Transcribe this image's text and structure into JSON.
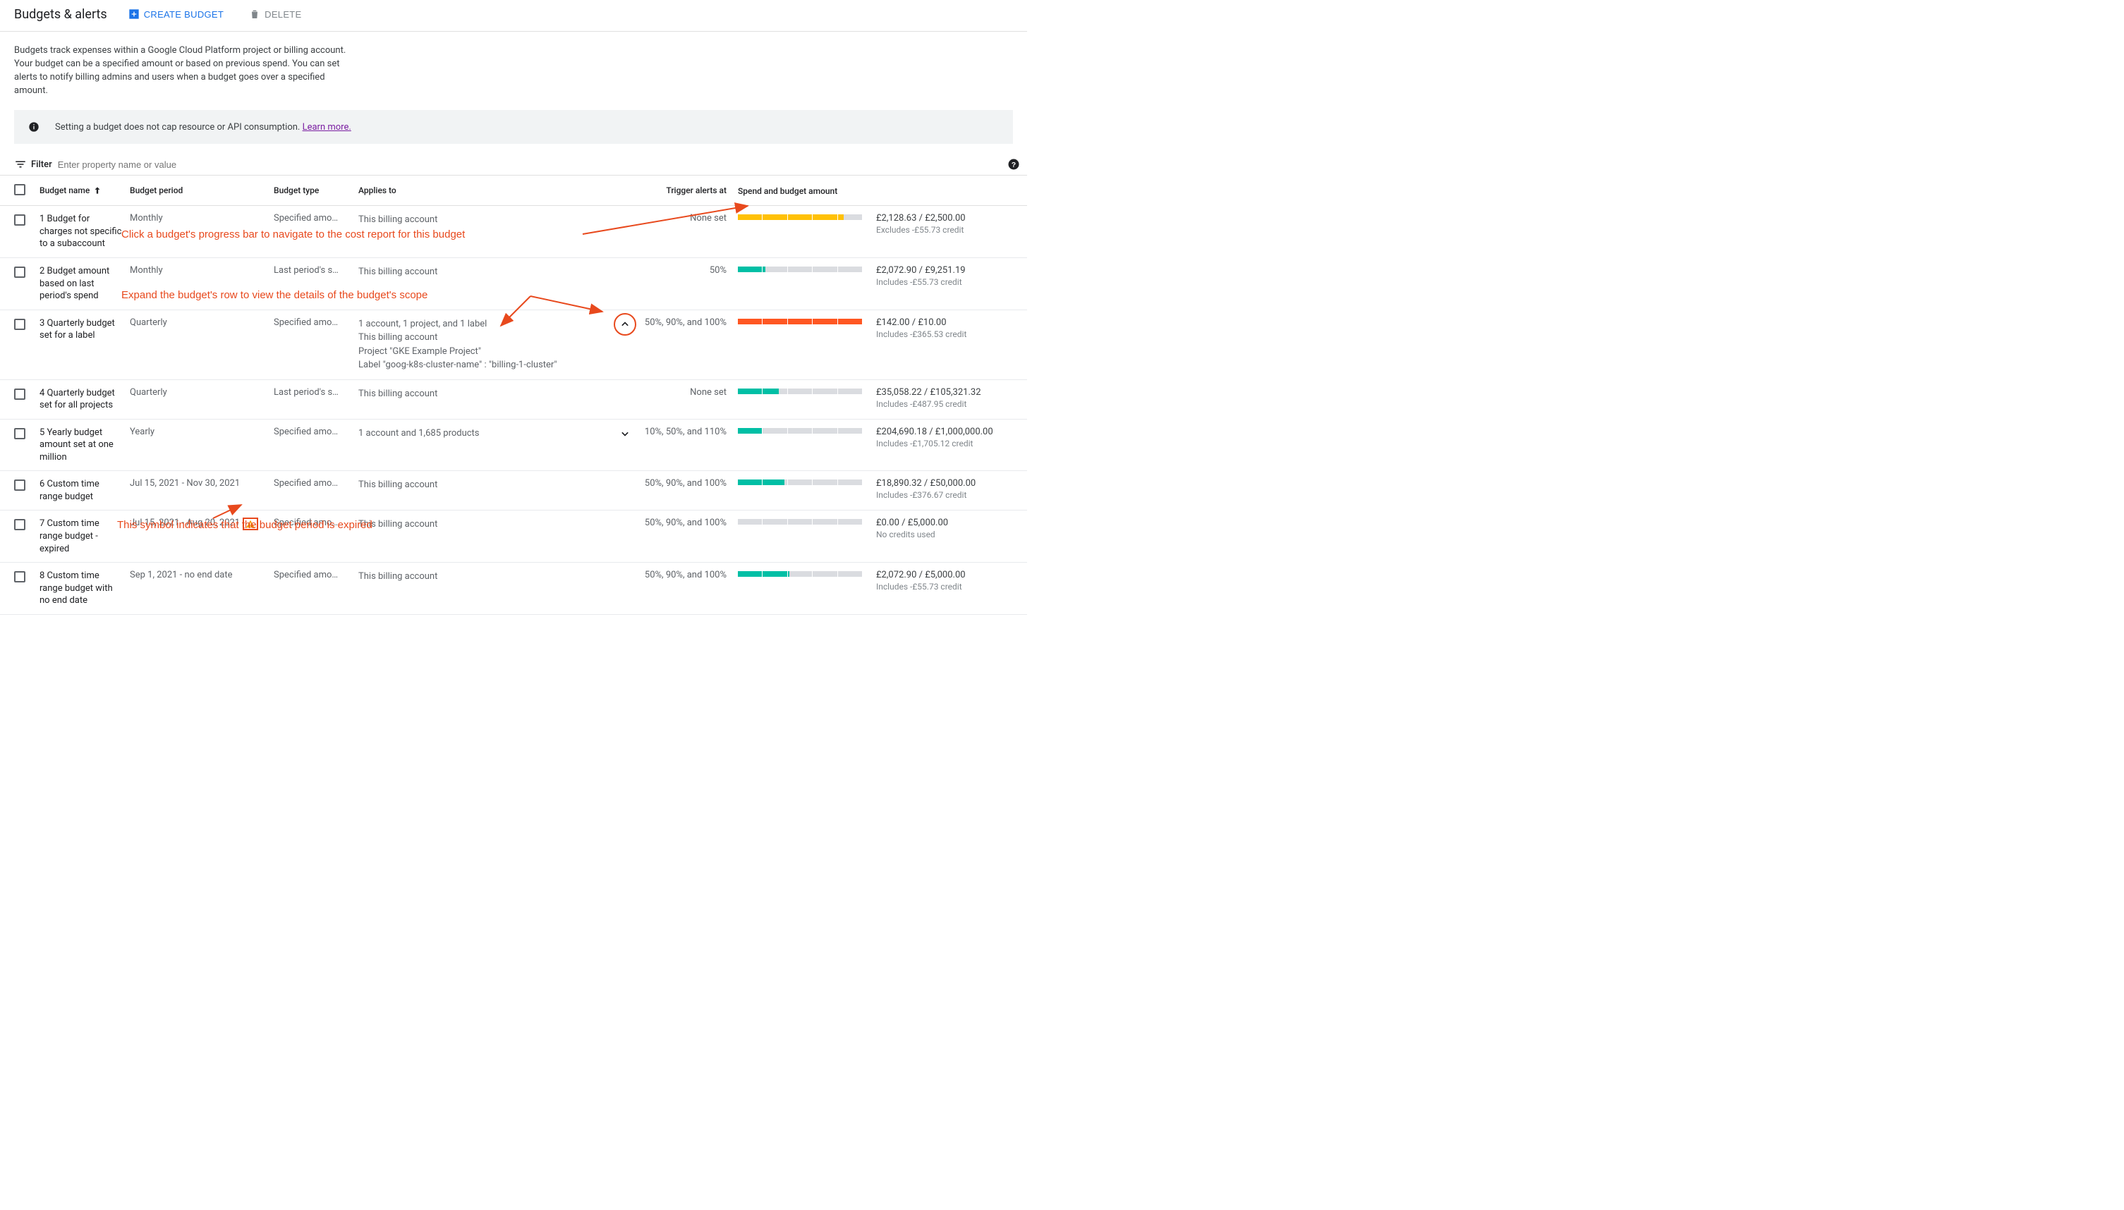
{
  "header": {
    "title": "Budgets & alerts",
    "create_label": "CREATE BUDGET",
    "delete_label": "DELETE"
  },
  "description": "Budgets track expenses within a Google Cloud Platform project or billing account. Your budget can be a specified amount or based on previous spend. You can set alerts to notify billing admins and users when a budget goes over a specified amount.",
  "banner": {
    "text": "Setting a budget does not cap resource or API consumption. ",
    "link_label": "Learn more."
  },
  "filter": {
    "label": "Filter",
    "placeholder": "Enter property name or value"
  },
  "columns": {
    "name": "Budget name",
    "period": "Budget period",
    "type": "Budget type",
    "applies": "Applies to",
    "trigger": "Trigger alerts at",
    "spend": "Spend and budget amount"
  },
  "rows": [
    {
      "name": "1 Budget for charges not specific to a subaccount",
      "period": "Monthly",
      "type": "Specified amo…",
      "applies": [
        "This billing account"
      ],
      "trigger": "None set",
      "bar": {
        "segments": [
          {
            "c": "yellow",
            "w": 85
          }
        ],
        "ticks": 5
      },
      "spend": "£2,128.63 / £2,500.00",
      "sub": "Excludes -£55.73 credit"
    },
    {
      "name": "2 Budget amount based on last period's spend",
      "period": "Monthly",
      "type": "Last period's s…",
      "applies": [
        "This billing account"
      ],
      "trigger": "50%",
      "bar": {
        "segments": [
          {
            "c": "teal",
            "w": 22
          }
        ],
        "ticks": 5
      },
      "spend": "£2,072.90 / £9,251.19",
      "sub": "Includes -£55.73 credit"
    },
    {
      "name": "3 Quarterly budget set for a label",
      "period": "Quarterly",
      "type": "Specified amo…",
      "applies": [
        "1 account, 1 project, and 1 label",
        "This billing account",
        "Project \"GKE Example Project\"",
        "Label \"goog-k8s-cluster-name\" : \"billing-1-cluster\""
      ],
      "expand": "up",
      "circled": true,
      "trigger": "50%, 90%, and 100%",
      "bar": {
        "segments": [
          {
            "c": "orange",
            "w": 100
          }
        ],
        "ticks": 5
      },
      "spend": "£142.00 / £10.00",
      "sub": "Includes -£365.53 credit"
    },
    {
      "name": "4 Quarterly budget set for all projects",
      "period": "Quarterly",
      "type": "Last period's s…",
      "applies": [
        "This billing account"
      ],
      "trigger": "None set",
      "bar": {
        "segments": [
          {
            "c": "teal",
            "w": 33
          }
        ],
        "ticks": 5
      },
      "spend": "£35,058.22 / £105,321.32",
      "sub": "Includes -£487.95 credit"
    },
    {
      "name": "5 Yearly budget amount set at one million",
      "period": "Yearly",
      "type": "Specified amo…",
      "applies": [
        "1 account and 1,685 products"
      ],
      "expand": "down",
      "trigger": "10%, 50%, and 110%",
      "bar": {
        "segments": [
          {
            "c": "teal",
            "w": 20
          }
        ],
        "ticks": 5
      },
      "spend": "£204,690.18 / £1,000,000.00",
      "sub": "Includes -£1,705.12 credit"
    },
    {
      "name": "6 Custom time range budget",
      "period": "Jul 15, 2021 - Nov 30, 2021",
      "type": "Specified amo…",
      "applies": [
        "This billing account"
      ],
      "trigger": "50%, 90%, and 100%",
      "bar": {
        "segments": [
          {
            "c": "teal",
            "w": 38
          }
        ],
        "ticks": 5
      },
      "spend": "£18,890.32 / £50,000.00",
      "sub": "Includes -£376.67 credit"
    },
    {
      "name": "7 Custom time range budget - expired",
      "period": "Jul 15, 2021 - Aug 20, 2021",
      "expired": true,
      "type": "Specified amo…",
      "applies": [
        "This billing account"
      ],
      "trigger": "50%, 90%, and 100%",
      "bar": {
        "segments": [
          {
            "c": "grey",
            "w": 0
          }
        ],
        "ticks": 5
      },
      "spend": "£0.00 / £5,000.00",
      "sub": "No credits used"
    },
    {
      "name": "8 Custom time range budget with no end date",
      "period": "Sep 1, 2021 - no end date",
      "type": "Specified amo…",
      "applies": [
        "This billing account"
      ],
      "trigger": "50%, 90%, and 100%",
      "bar": {
        "segments": [
          {
            "c": "teal",
            "w": 41
          }
        ],
        "ticks": 5
      },
      "spend": "£2,072.90 / £5,000.00",
      "sub": "Includes -£55.73 credit"
    }
  ],
  "annotations": {
    "progress": "Click a budget's progress bar to navigate to the cost report for this budget",
    "expand": "Expand the budget's row to view the details of the budget's scope",
    "expired": "This symbol indicates that the budget period is expired"
  }
}
